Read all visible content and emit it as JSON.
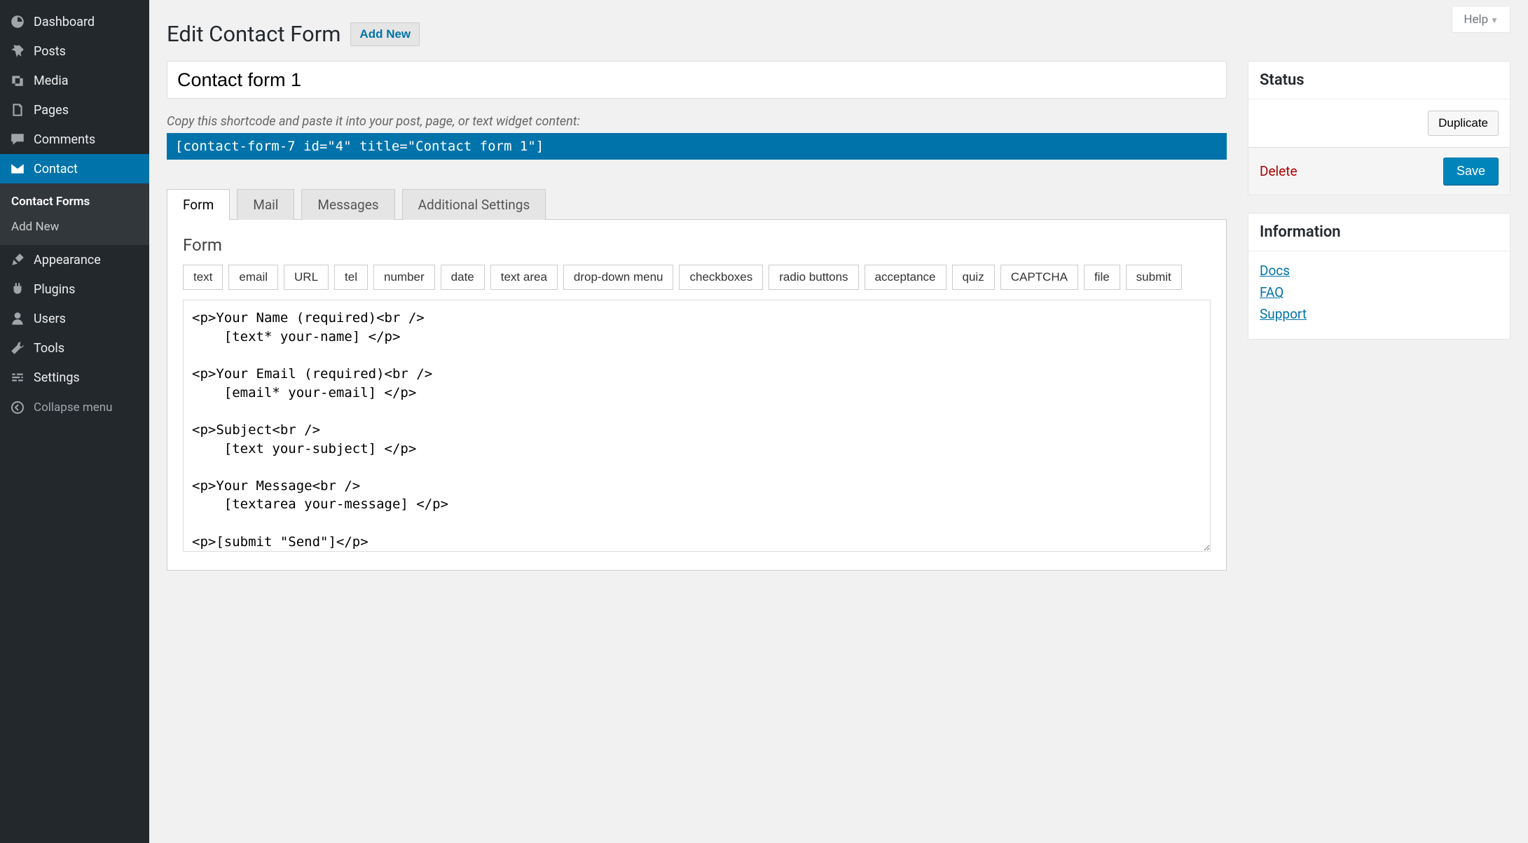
{
  "sidebar": {
    "items": [
      {
        "label": "Dashboard",
        "icon": "dashboard"
      },
      {
        "label": "Posts",
        "icon": "pin"
      },
      {
        "label": "Media",
        "icon": "media"
      },
      {
        "label": "Pages",
        "icon": "pages"
      },
      {
        "label": "Comments",
        "icon": "comments"
      },
      {
        "label": "Contact",
        "icon": "contact",
        "active": true
      },
      {
        "label": "Appearance",
        "icon": "appearance"
      },
      {
        "label": "Plugins",
        "icon": "plugins"
      },
      {
        "label": "Users",
        "icon": "users"
      },
      {
        "label": "Tools",
        "icon": "tools"
      },
      {
        "label": "Settings",
        "icon": "settings"
      }
    ],
    "submenu": [
      {
        "label": "Contact Forms",
        "current": true
      },
      {
        "label": "Add New",
        "current": false
      }
    ],
    "collapse_label": "Collapse menu"
  },
  "header": {
    "help_label": "Help",
    "page_title": "Edit Contact Form",
    "add_new_label": "Add New"
  },
  "form": {
    "title_value": "Contact form 1",
    "shortcode_hint": "Copy this shortcode and paste it into your post, page, or text widget content:",
    "shortcode_value": "[contact-form-7 id=\"4\" title=\"Contact form 1\"]",
    "tabs": [
      {
        "label": "Form",
        "active": true
      },
      {
        "label": "Mail"
      },
      {
        "label": "Messages"
      },
      {
        "label": "Additional Settings"
      }
    ],
    "panel_heading": "Form",
    "tag_buttons": [
      "text",
      "email",
      "URL",
      "tel",
      "number",
      "date",
      "text area",
      "drop-down menu",
      "checkboxes",
      "radio buttons",
      "acceptance",
      "quiz",
      "CAPTCHA",
      "file",
      "submit"
    ],
    "textarea_value": "<p>Your Name (required)<br />\n    [text* your-name] </p>\n\n<p>Your Email (required)<br />\n    [email* your-email] </p>\n\n<p>Subject<br />\n    [text your-subject] </p>\n\n<p>Your Message<br />\n    [textarea your-message] </p>\n\n<p>[submit \"Send\"]</p>"
  },
  "status_box": {
    "heading": "Status",
    "duplicate_label": "Duplicate",
    "delete_label": "Delete",
    "save_label": "Save"
  },
  "info_box": {
    "heading": "Information",
    "links": [
      "Docs",
      "FAQ",
      "Support"
    ]
  }
}
